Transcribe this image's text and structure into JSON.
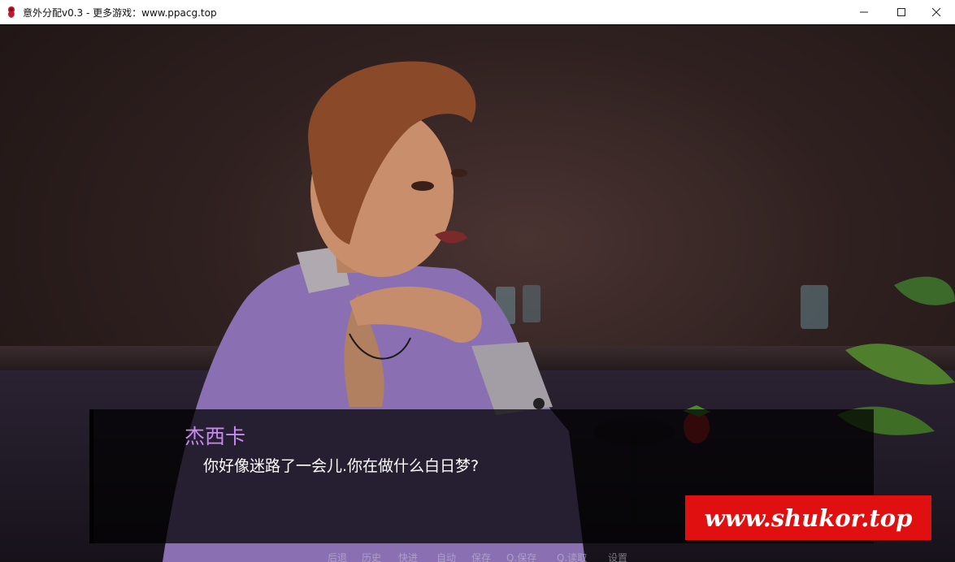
{
  "window": {
    "title": "意外分配v0.3 - 更多游戏：www.ppacg.top",
    "icon": "app-icon",
    "controls": [
      "minimize-icon",
      "maximize-icon",
      "close-icon"
    ]
  },
  "dialogue": {
    "speaker": "杰西卡",
    "text": "你好像迷路了一会儿.你在做什么白日梦?",
    "speaker_color": "#c98af0"
  },
  "watermark": {
    "text": "www.shukor.top",
    "background": "#e01010"
  },
  "quick_menu": {
    "items": [
      "后退",
      "历史",
      "快进",
      "自动",
      "保存",
      "Q.保存",
      "Q.读取",
      "设置"
    ]
  }
}
